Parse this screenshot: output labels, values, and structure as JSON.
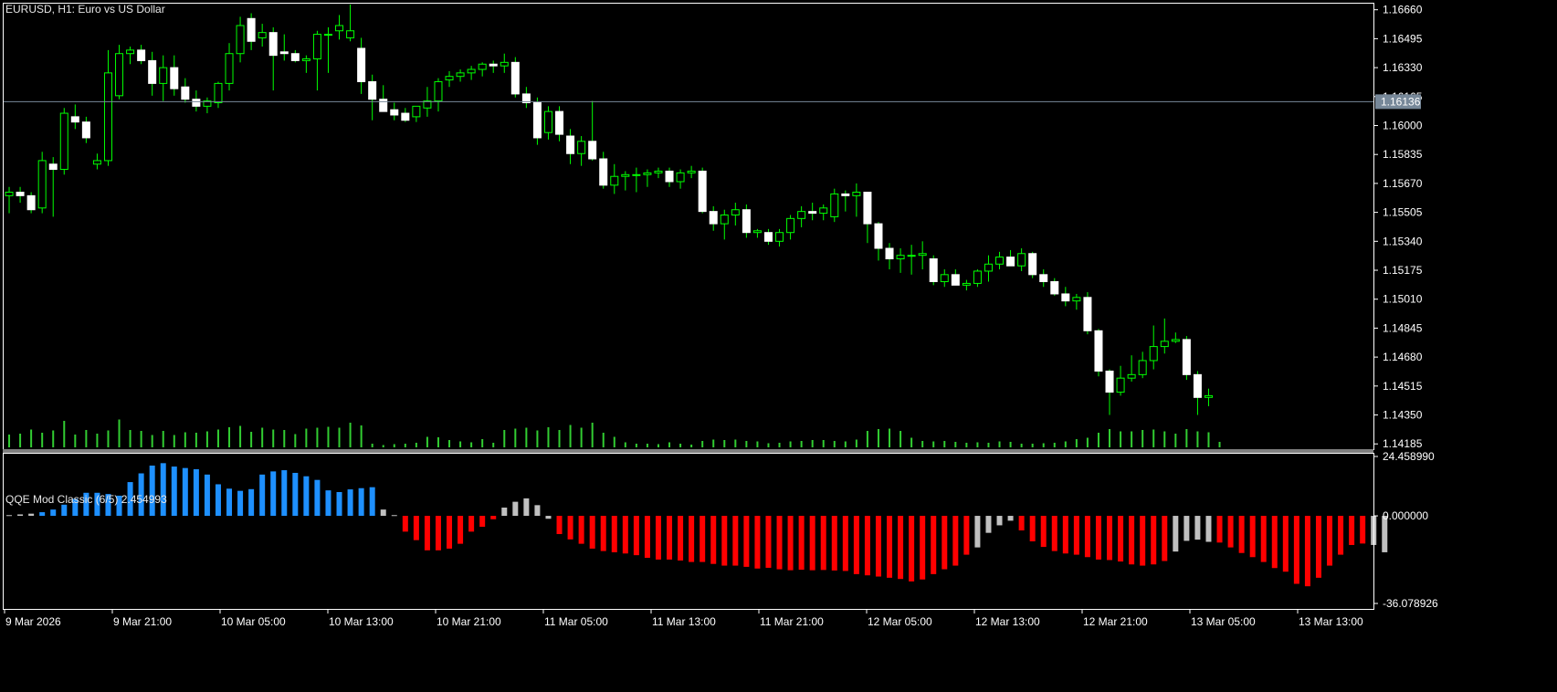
{
  "window": {
    "symbol_title": "EURUSD, H1:  Euro vs US Dollar",
    "indicator_title": "QQE Mod Classic (6/5) 2.454993"
  },
  "colors": {
    "background": "#000000",
    "frame": "#ffffff",
    "bull_candle": "#00ff00",
    "bear_candle_body": "#ffffff",
    "volume": "#32cd32",
    "qqe_blue": "#1e90ff",
    "qqe_red": "#ff0000",
    "qqe_gray": "#c0c0c0",
    "bid_line": "#778899",
    "axis_text": "#ffffff"
  },
  "chart_data": [
    {
      "type": "candlestick",
      "name": "EURUSD H1",
      "y_axis_ticks": [
        "1.16660",
        "1.16495",
        "1.16330",
        "1.16165",
        "1.16000",
        "1.15835",
        "1.15670",
        "1.15505",
        "1.15340",
        "1.15175",
        "1.15010",
        "1.14845",
        "1.14680",
        "1.14515",
        "1.14350",
        "1.14185"
      ],
      "ylim": [
        1.14155,
        1.167
      ],
      "current_price_label": "1.16136",
      "current_price": 1.16136,
      "grid": false,
      "x_axis_ticks": [
        "9 Mar 2026",
        "9 Mar 21:00",
        "10 Mar 05:00",
        "10 Mar 13:00",
        "10 Mar 21:00",
        "11 Mar 05:00",
        "11 Mar 13:00",
        "11 Mar 21:00",
        "12 Mar 05:00",
        "12 Mar 13:00",
        "12 Mar 21:00",
        "13 Mar 05:00",
        "13 Mar 13:00"
      ],
      "candles": [
        [
          1.156,
          1.1565,
          1.155,
          1.1562
        ],
        [
          1.1562,
          1.1565,
          1.1556,
          1.156
        ],
        [
          1.156,
          1.1562,
          1.155,
          1.1552
        ],
        [
          1.1553,
          1.1585,
          1.155,
          1.158
        ],
        [
          1.1578,
          1.1582,
          1.1548,
          1.1575
        ],
        [
          1.1575,
          1.161,
          1.1572,
          1.1607
        ],
        [
          1.1605,
          1.1612,
          1.1598,
          1.1602
        ],
        [
          1.1602,
          1.1605,
          1.159,
          1.1593
        ],
        [
          1.1578,
          1.1584,
          1.1575,
          1.158
        ],
        [
          1.158,
          1.1643,
          1.1577,
          1.163
        ],
        [
          1.1617,
          1.1646,
          1.1615,
          1.1641
        ],
        [
          1.1641,
          1.1645,
          1.1635,
          1.1643
        ],
        [
          1.1643,
          1.1646,
          1.1635,
          1.1637
        ],
        [
          1.1637,
          1.1642,
          1.1617,
          1.1624
        ],
        [
          1.1624,
          1.164,
          1.1614,
          1.1633
        ],
        [
          1.1633,
          1.164,
          1.1617,
          1.1621
        ],
        [
          1.1622,
          1.1627,
          1.1613,
          1.1615
        ],
        [
          1.1615,
          1.162,
          1.1608,
          1.1611
        ],
        [
          1.1611,
          1.1616,
          1.1607,
          1.1614
        ],
        [
          1.1613,
          1.1625,
          1.161,
          1.1624
        ],
        [
          1.1624,
          1.1647,
          1.162,
          1.1641
        ],
        [
          1.1641,
          1.1662,
          1.1636,
          1.1657
        ],
        [
          1.1661,
          1.1664,
          1.1643,
          1.1648
        ],
        [
          1.165,
          1.1658,
          1.1645,
          1.1653
        ],
        [
          1.1653,
          1.1656,
          1.162,
          1.164
        ],
        [
          1.1642,
          1.1652,
          1.1637,
          1.1641
        ],
        [
          1.1641,
          1.1643,
          1.1636,
          1.1637
        ],
        [
          1.1637,
          1.164,
          1.163,
          1.1638
        ],
        [
          1.1638,
          1.1654,
          1.162,
          1.1652
        ],
        [
          1.1652,
          1.1656,
          1.163,
          1.1652
        ],
        [
          1.1654,
          1.1663,
          1.1649,
          1.1657
        ],
        [
          1.165,
          1.1669,
          1.1648,
          1.1654
        ],
        [
          1.1644,
          1.165,
          1.1618,
          1.1625
        ],
        [
          1.1625,
          1.1629,
          1.1603,
          1.1615
        ],
        [
          1.1615,
          1.1623,
          1.161,
          1.1608
        ],
        [
          1.1609,
          1.1613,
          1.1603,
          1.1606
        ],
        [
          1.1607,
          1.161,
          1.1602,
          1.1603
        ],
        [
          1.1605,
          1.1611,
          1.1602,
          1.1611
        ],
        [
          1.161,
          1.1622,
          1.1605,
          1.1614
        ],
        [
          1.1614,
          1.1627,
          1.1608,
          1.1625
        ],
        [
          1.1626,
          1.1631,
          1.1622,
          1.1628
        ],
        [
          1.1628,
          1.1632,
          1.1625,
          1.163
        ],
        [
          1.163,
          1.1634,
          1.1626,
          1.1632
        ],
        [
          1.1632,
          1.1636,
          1.1628,
          1.1635
        ],
        [
          1.1635,
          1.1637,
          1.163,
          1.1634
        ],
        [
          1.1634,
          1.1641,
          1.163,
          1.1636
        ],
        [
          1.1636,
          1.1639,
          1.1616,
          1.1618
        ],
        [
          1.1618,
          1.1622,
          1.161,
          1.1613
        ],
        [
          1.1613,
          1.1616,
          1.1589,
          1.1593
        ],
        [
          1.1596,
          1.1611,
          1.1592,
          1.1608
        ],
        [
          1.1608,
          1.1611,
          1.1591,
          1.1595
        ],
        [
          1.1594,
          1.1598,
          1.1578,
          1.1584
        ],
        [
          1.1584,
          1.1594,
          1.1577,
          1.1591
        ],
        [
          1.1591,
          1.1614,
          1.158,
          1.1581
        ],
        [
          1.1581,
          1.1585,
          1.1564,
          1.1566
        ],
        [
          1.1566,
          1.1578,
          1.1561,
          1.1571
        ],
        [
          1.1571,
          1.1574,
          1.1563,
          1.1572
        ],
        [
          1.1572,
          1.1576,
          1.1562,
          1.1572
        ],
        [
          1.1572,
          1.1575,
          1.1565,
          1.1573
        ],
        [
          1.1573,
          1.1576,
          1.157,
          1.1574
        ],
        [
          1.1574,
          1.1576,
          1.1565,
          1.1568
        ],
        [
          1.1568,
          1.1575,
          1.1564,
          1.1573
        ],
        [
          1.1573,
          1.1577,
          1.157,
          1.1574
        ],
        [
          1.1574,
          1.1576,
          1.155,
          1.1551
        ],
        [
          1.1551,
          1.1554,
          1.154,
          1.1544
        ],
        [
          1.1544,
          1.1552,
          1.1535,
          1.1549
        ],
        [
          1.1549,
          1.1556,
          1.1543,
          1.1552
        ],
        [
          1.1552,
          1.1555,
          1.1536,
          1.1539
        ],
        [
          1.1539,
          1.1541,
          1.1536,
          1.154
        ],
        [
          1.1539,
          1.1541,
          1.1532,
          1.1534
        ],
        [
          1.1534,
          1.1541,
          1.1531,
          1.1539
        ],
        [
          1.1539,
          1.1549,
          1.1535,
          1.1547
        ],
        [
          1.1547,
          1.1554,
          1.1542,
          1.1551
        ],
        [
          1.1551,
          1.1556,
          1.1546,
          1.155
        ],
        [
          1.155,
          1.1555,
          1.1546,
          1.1553
        ],
        [
          1.1548,
          1.1564,
          1.1545,
          1.1561
        ],
        [
          1.1561,
          1.1563,
          1.1551,
          1.156
        ],
        [
          1.156,
          1.1567,
          1.1548,
          1.1562
        ],
        [
          1.1562,
          1.1562,
          1.1533,
          1.1544
        ],
        [
          1.1544,
          1.1545,
          1.1523,
          1.153
        ],
        [
          1.153,
          1.1533,
          1.1518,
          1.1524
        ],
        [
          1.1524,
          1.153,
          1.1516,
          1.1526
        ],
        [
          1.1526,
          1.1532,
          1.1515,
          1.1526
        ],
        [
          1.1526,
          1.1534,
          1.1518,
          1.1527
        ],
        [
          1.1524,
          1.1526,
          1.1509,
          1.1511
        ],
        [
          1.1511,
          1.1518,
          1.1508,
          1.1515
        ],
        [
          1.1515,
          1.1518,
          1.151,
          1.1509
        ],
        [
          1.1509,
          1.1512,
          1.1506,
          1.151
        ],
        [
          1.151,
          1.1518,
          1.1508,
          1.1517
        ],
        [
          1.1517,
          1.1526,
          1.1511,
          1.1521
        ],
        [
          1.1521,
          1.1528,
          1.1518,
          1.1525
        ],
        [
          1.1525,
          1.1529,
          1.152,
          1.152
        ],
        [
          1.152,
          1.153,
          1.1517,
          1.1527
        ],
        [
          1.1527,
          1.1528,
          1.1513,
          1.1515
        ],
        [
          1.1515,
          1.1518,
          1.1508,
          1.1511
        ],
        [
          1.1511,
          1.1513,
          1.1503,
          1.1504
        ],
        [
          1.1504,
          1.1508,
          1.1497,
          1.15
        ],
        [
          1.15,
          1.1504,
          1.1495,
          1.1502
        ],
        [
          1.1502,
          1.1505,
          1.1481,
          1.1483
        ],
        [
          1.1483,
          1.1484,
          1.1457,
          1.146
        ],
        [
          1.146,
          1.1461,
          1.1435,
          1.1448
        ],
        [
          1.1448,
          1.1463,
          1.1446,
          1.1456
        ],
        [
          1.1456,
          1.1469,
          1.1454,
          1.1458
        ],
        [
          1.1458,
          1.1471,
          1.1456,
          1.1466
        ],
        [
          1.1466,
          1.1486,
          1.1461,
          1.1474
        ],
        [
          1.1474,
          1.149,
          1.147,
          1.1477
        ],
        [
          1.1477,
          1.1482,
          1.1476,
          1.1478
        ],
        [
          1.1478,
          1.148,
          1.1455,
          1.1458
        ],
        [
          1.1458,
          1.146,
          1.1435,
          1.1445
        ],
        [
          1.1445,
          1.145,
          1.144,
          1.1446
        ]
      ],
      "volume": [
        0.28,
        0.3,
        0.39,
        0.32,
        0.37,
        0.58,
        0.28,
        0.38,
        0.3,
        0.37,
        0.61,
        0.38,
        0.36,
        0.27,
        0.36,
        0.27,
        0.33,
        0.32,
        0.35,
        0.39,
        0.44,
        0.47,
        0.34,
        0.43,
        0.39,
        0.38,
        0.29,
        0.41,
        0.43,
        0.45,
        0.43,
        0.54,
        0.48,
        0.08,
        0.05,
        0.07,
        0.08,
        0.1,
        0.23,
        0.22,
        0.16,
        0.13,
        0.11,
        0.18,
        0.1,
        0.38,
        0.41,
        0.43,
        0.37,
        0.44,
        0.38,
        0.49,
        0.43,
        0.54,
        0.32,
        0.23,
        0.11,
        0.08,
        0.08,
        0.07,
        0.11,
        0.08,
        0.06,
        0.14,
        0.17,
        0.16,
        0.17,
        0.14,
        0.13,
        0.09,
        0.1,
        0.13,
        0.14,
        0.16,
        0.16,
        0.14,
        0.13,
        0.17,
        0.36,
        0.4,
        0.41,
        0.36,
        0.21,
        0.14,
        0.13,
        0.14,
        0.12,
        0.1,
        0.11,
        0.1,
        0.13,
        0.12,
        0.08,
        0.08,
        0.09,
        0.1,
        0.13,
        0.18,
        0.21,
        0.32,
        0.4,
        0.35,
        0.35,
        0.38,
        0.39,
        0.35,
        0.3,
        0.4,
        0.35,
        0.33,
        0.12
      ]
    },
    {
      "type": "bar",
      "name": "QQE Mod Classic (6/5)",
      "y_axis_ticks": [
        "24.458990",
        "0.000000",
        "-36.078926"
      ],
      "ylim": [
        -36.078926,
        24.45899
      ],
      "values": [
        0.3,
        0.6,
        0.9,
        1.5,
        2.6,
        4.6,
        7.0,
        9.5,
        9.5,
        9.0,
        8.3,
        13.9,
        17.5,
        20.7,
        21.7,
        20.3,
        19.7,
        19.2,
        17.0,
        13.0,
        11.2,
        10.3,
        11.0,
        17.0,
        18.3,
        18.8,
        17.7,
        16.3,
        14.8,
        10.5,
        9.8,
        10.9,
        11.4,
        11.8,
        2.6,
        0.3,
        -6.5,
        -10.0,
        -14.2,
        -14.2,
        -13.5,
        -11.5,
        -6.5,
        -4.5,
        -1.4,
        3.4,
        5.8,
        7.2,
        4.4,
        -1.2,
        -7.5,
        -9.7,
        -11.5,
        -13.5,
        -14.5,
        -15.0,
        -15.5,
        -16.2,
        -17.3,
        -18.0,
        -18.0,
        -18.4,
        -19.0,
        -19.0,
        -19.8,
        -20.5,
        -20.5,
        -21.0,
        -21.7,
        -21.4,
        -22.0,
        -22.4,
        -22.2,
        -22.4,
        -22.3,
        -22.5,
        -22.7,
        -24.0,
        -24.5,
        -25.0,
        -25.5,
        -26.0,
        -27.0,
        -26.2,
        -24.0,
        -22.0,
        -20.5,
        -16.0,
        -13.0,
        -7.0,
        -3.9,
        -2.0,
        -6.0,
        -10.5,
        -12.8,
        -14.5,
        -15.5,
        -16.0,
        -17.0,
        -18.0,
        -18.2,
        -18.8,
        -20.0,
        -20.5,
        -20.0,
        -18.6,
        -14.7,
        -10.3,
        -9.8,
        -10.7,
        -11.0,
        -13.0,
        -15.3,
        -17.0,
        -19.0,
        -21.5,
        -23.0,
        -28.0,
        -29.0,
        -25.5,
        -20.5,
        -16.0,
        -12.0,
        -11.4,
        -12.0,
        -15.0
      ],
      "bar_colors": [
        "gray",
        "gray",
        "gray",
        "blue",
        "blue",
        "blue",
        "blue",
        "blue",
        "blue",
        "blue",
        "blue",
        "blue",
        "blue",
        "blue",
        "blue",
        "blue",
        "blue",
        "blue",
        "blue",
        "blue",
        "blue",
        "blue",
        "blue",
        "blue",
        "blue",
        "blue",
        "blue",
        "blue",
        "blue",
        "blue",
        "blue",
        "blue",
        "blue",
        "blue",
        "gray",
        "gray",
        "red",
        "red",
        "red",
        "red",
        "red",
        "red",
        "red",
        "red",
        "red",
        "gray",
        "gray",
        "gray",
        "gray",
        "gray",
        "red",
        "red",
        "red",
        "red",
        "red",
        "red",
        "red",
        "red",
        "red",
        "red",
        "red",
        "red",
        "red",
        "red",
        "red",
        "red",
        "red",
        "red",
        "red",
        "red",
        "red",
        "red",
        "red",
        "red",
        "red",
        "red",
        "red",
        "red",
        "red",
        "red",
        "red",
        "red",
        "red",
        "red",
        "red",
        "red",
        "red",
        "red",
        "gray",
        "gray",
        "gray",
        "gray",
        "red",
        "red",
        "red",
        "red",
        "red",
        "red",
        "red",
        "red",
        "red",
        "red",
        "red",
        "red",
        "red",
        "red",
        "gray",
        "gray",
        "gray",
        "gray",
        "red",
        "red",
        "red",
        "red",
        "red",
        "red",
        "red",
        "red",
        "red",
        "red",
        "red",
        "red",
        "red",
        "red",
        "gray",
        "gray",
        "gray",
        "red"
      ]
    }
  ]
}
